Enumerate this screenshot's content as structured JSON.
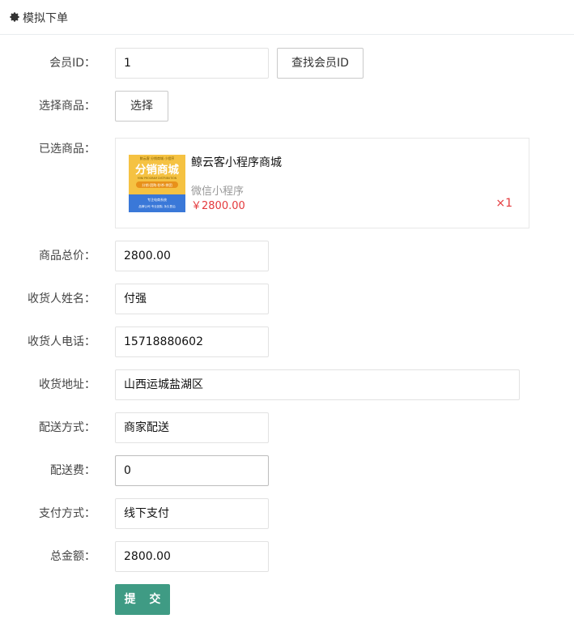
{
  "header": {
    "title": "模拟下单",
    "icon": "gear-icon"
  },
  "form": {
    "member_id": {
      "label": "会员ID：",
      "value": "1",
      "button": "查找会员ID"
    },
    "select_product": {
      "label": "选择商品：",
      "button": "选择"
    },
    "selected_products": {
      "label": "已选商品：",
      "items": [
        {
          "name": "鲸云客小程序商城",
          "type": "微信小程序",
          "price": "￥2800.00",
          "qty": "×1",
          "thumb": {
            "top_text": "鲸云客 分销商城 小程序",
            "headline": "分销商城",
            "subline": "MINI PROGRAM DISTRIBUTION",
            "tags": "分销·团购·秒杀·拼团",
            "band1": "专注电商系统",
            "band2": "品牌公司 专业团队 永久售后"
          }
        }
      ]
    },
    "total_goods_price": {
      "label": "商品总价：",
      "value": "2800.00"
    },
    "receiver_name": {
      "label": "收货人姓名：",
      "value": "付强"
    },
    "receiver_phone": {
      "label": "收货人电话：",
      "value": "15718880602"
    },
    "receiver_address": {
      "label": "收货地址：",
      "value": "山西运城盐湖区"
    },
    "delivery_method": {
      "label": "配送方式：",
      "value": "商家配送"
    },
    "delivery_fee": {
      "label": "配送费：",
      "value": "0"
    },
    "payment_method": {
      "label": "支付方式：",
      "value": "线下支付"
    },
    "total_amount": {
      "label": "总金额：",
      "value": "2800.00"
    },
    "submit": "提 交"
  },
  "colors": {
    "accent": "#3f9b84",
    "price": "#e4393c",
    "thumb_yellow": "#f5c242",
    "thumb_blue": "#3a78d8"
  }
}
